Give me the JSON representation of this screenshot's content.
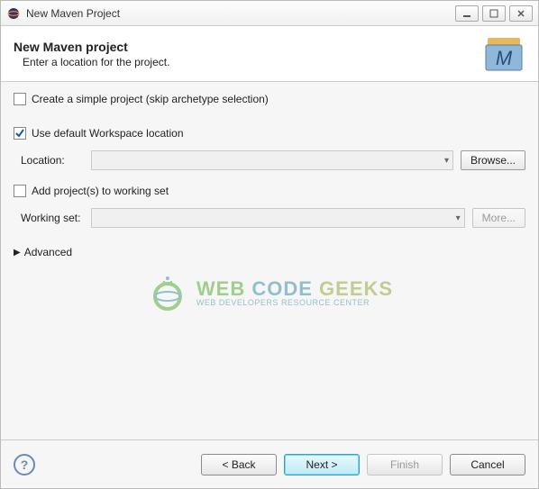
{
  "window": {
    "title": "New Maven Project"
  },
  "banner": {
    "heading": "New Maven project",
    "subtext": "Enter a location for the project."
  },
  "options": {
    "simple_project_label": "Create a simple project (skip archetype selection)",
    "simple_project_checked": false,
    "use_default_label": "Use default Workspace location",
    "use_default_checked": true,
    "location_label": "Location:",
    "location_value": "",
    "browse_label": "Browse...",
    "working_set_checkbox": "Add project(s) to working set",
    "working_set_checked": false,
    "working_set_label": "Working set:",
    "working_set_value": "",
    "more_label": "More...",
    "advanced_label": "Advanced"
  },
  "footer": {
    "back": "< Back",
    "next": "Next >",
    "finish": "Finish",
    "cancel": "Cancel"
  },
  "watermark": {
    "main": "WEB CODE GEEKS",
    "sub": "WEB DEVELOPERS RESOURCE CENTER"
  }
}
